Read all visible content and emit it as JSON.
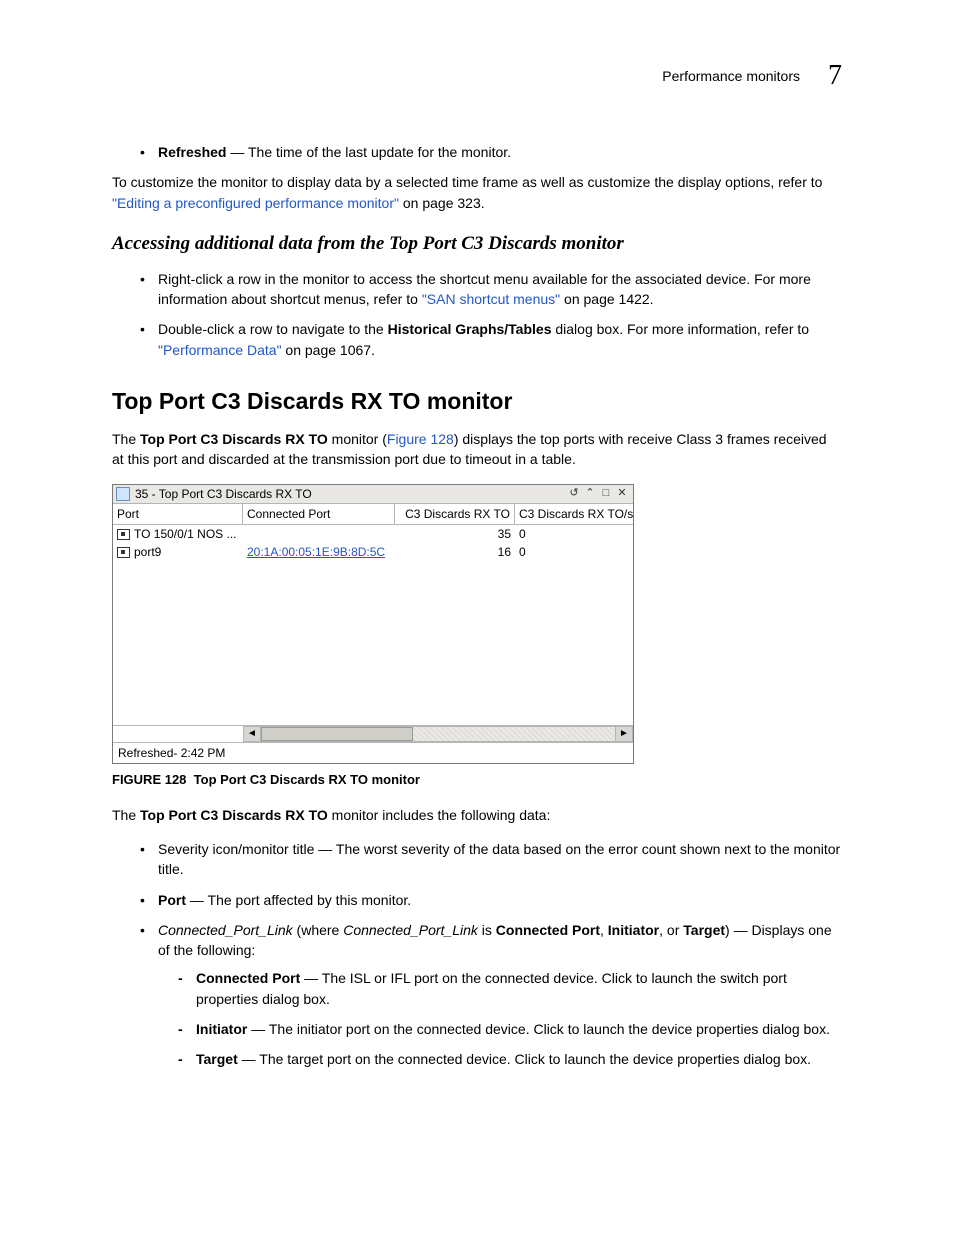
{
  "header": {
    "section": "Performance monitors",
    "chapter": "7"
  },
  "intro_bullet": {
    "term": "Refreshed",
    "desc": " — The time of the last update for the monitor."
  },
  "intro_para": {
    "t1": "To customize the monitor to display data by a selected time frame as well as customize the display options, refer to ",
    "link": "\"Editing a preconfigured performance monitor\"",
    "t2": " on page 323."
  },
  "section1_heading": "Accessing additional data from the Top Port C3 Discards monitor",
  "section1_bullets": [
    {
      "t1": "Right-click a row in the monitor to access the shortcut menu available for the associated device. For more information about shortcut menus, refer to ",
      "link": "\"SAN shortcut menus\"",
      "t2": " on page 1422."
    },
    {
      "t1": "Double-click a row to navigate to the ",
      "bold": "Historical Graphs/Tables",
      "t2": " dialog box. For more information, refer to ",
      "link": "\"Performance Data\"",
      "t3": " on page 1067."
    }
  ],
  "section2_heading": "Top Port C3 Discards RX TO monitor",
  "section2_intro": {
    "t1": "The ",
    "bold": "Top Port C3 Discards RX TO",
    "t2": " monitor (",
    "link": "Figure 128",
    "t3": ") displays the top ports with receive Class 3 frames received at this port and discarded at the transmission port due to timeout in a table."
  },
  "monitor": {
    "title": "35 - Top Port C3 Discards RX TO",
    "columns": [
      "Port",
      "Connected Port",
      "C3 Discards RX TO",
      "C3 Discards RX TO/sec"
    ],
    "rows": [
      {
        "port": "TO 150/0/1 NOS ...",
        "connected": "",
        "c3": "35",
        "c3sec": "0"
      },
      {
        "port": "port9",
        "connected": "20:1A:00:05:1E:9B:8D:5C",
        "c3": "16",
        "c3sec": "0"
      }
    ],
    "status": "Refreshed- 2:42 PM"
  },
  "figure_caption": {
    "label": "FIGURE 128",
    "text": "Top Port C3 Discards RX TO monitor"
  },
  "section2_includes": {
    "t1": "The ",
    "bold": "Top Port C3 Discards RX TO",
    "t2": " monitor includes the following data:"
  },
  "data_list": {
    "severity": "Severity icon/monitor title — The worst severity of the data based on the error count shown next to the monitor title.",
    "port_label": "Port",
    "port_desc": " — The port affected by this monitor.",
    "cpl": {
      "i1": "Connected_Port_Link",
      "t1": " (where ",
      "i2": "Connected_Port_Link",
      "t2": " is ",
      "b1": "Connected Port",
      "c1": ", ",
      "b2": "Initiator",
      "c2": ", or ",
      "b3": "Target",
      "t3": ") — Displays one of the following:"
    },
    "sub": {
      "cp_label": "Connected Port",
      "cp_desc": " — The ISL or IFL port on the connected device. Click to launch the switch port properties dialog box.",
      "init_label": "Initiator",
      "init_desc": " — The initiator port on the connected device. Click to launch the device properties dialog box.",
      "tgt_label": "Target",
      "tgt_desc": " — The target port on the connected device. Click to launch the device properties dialog box."
    }
  }
}
